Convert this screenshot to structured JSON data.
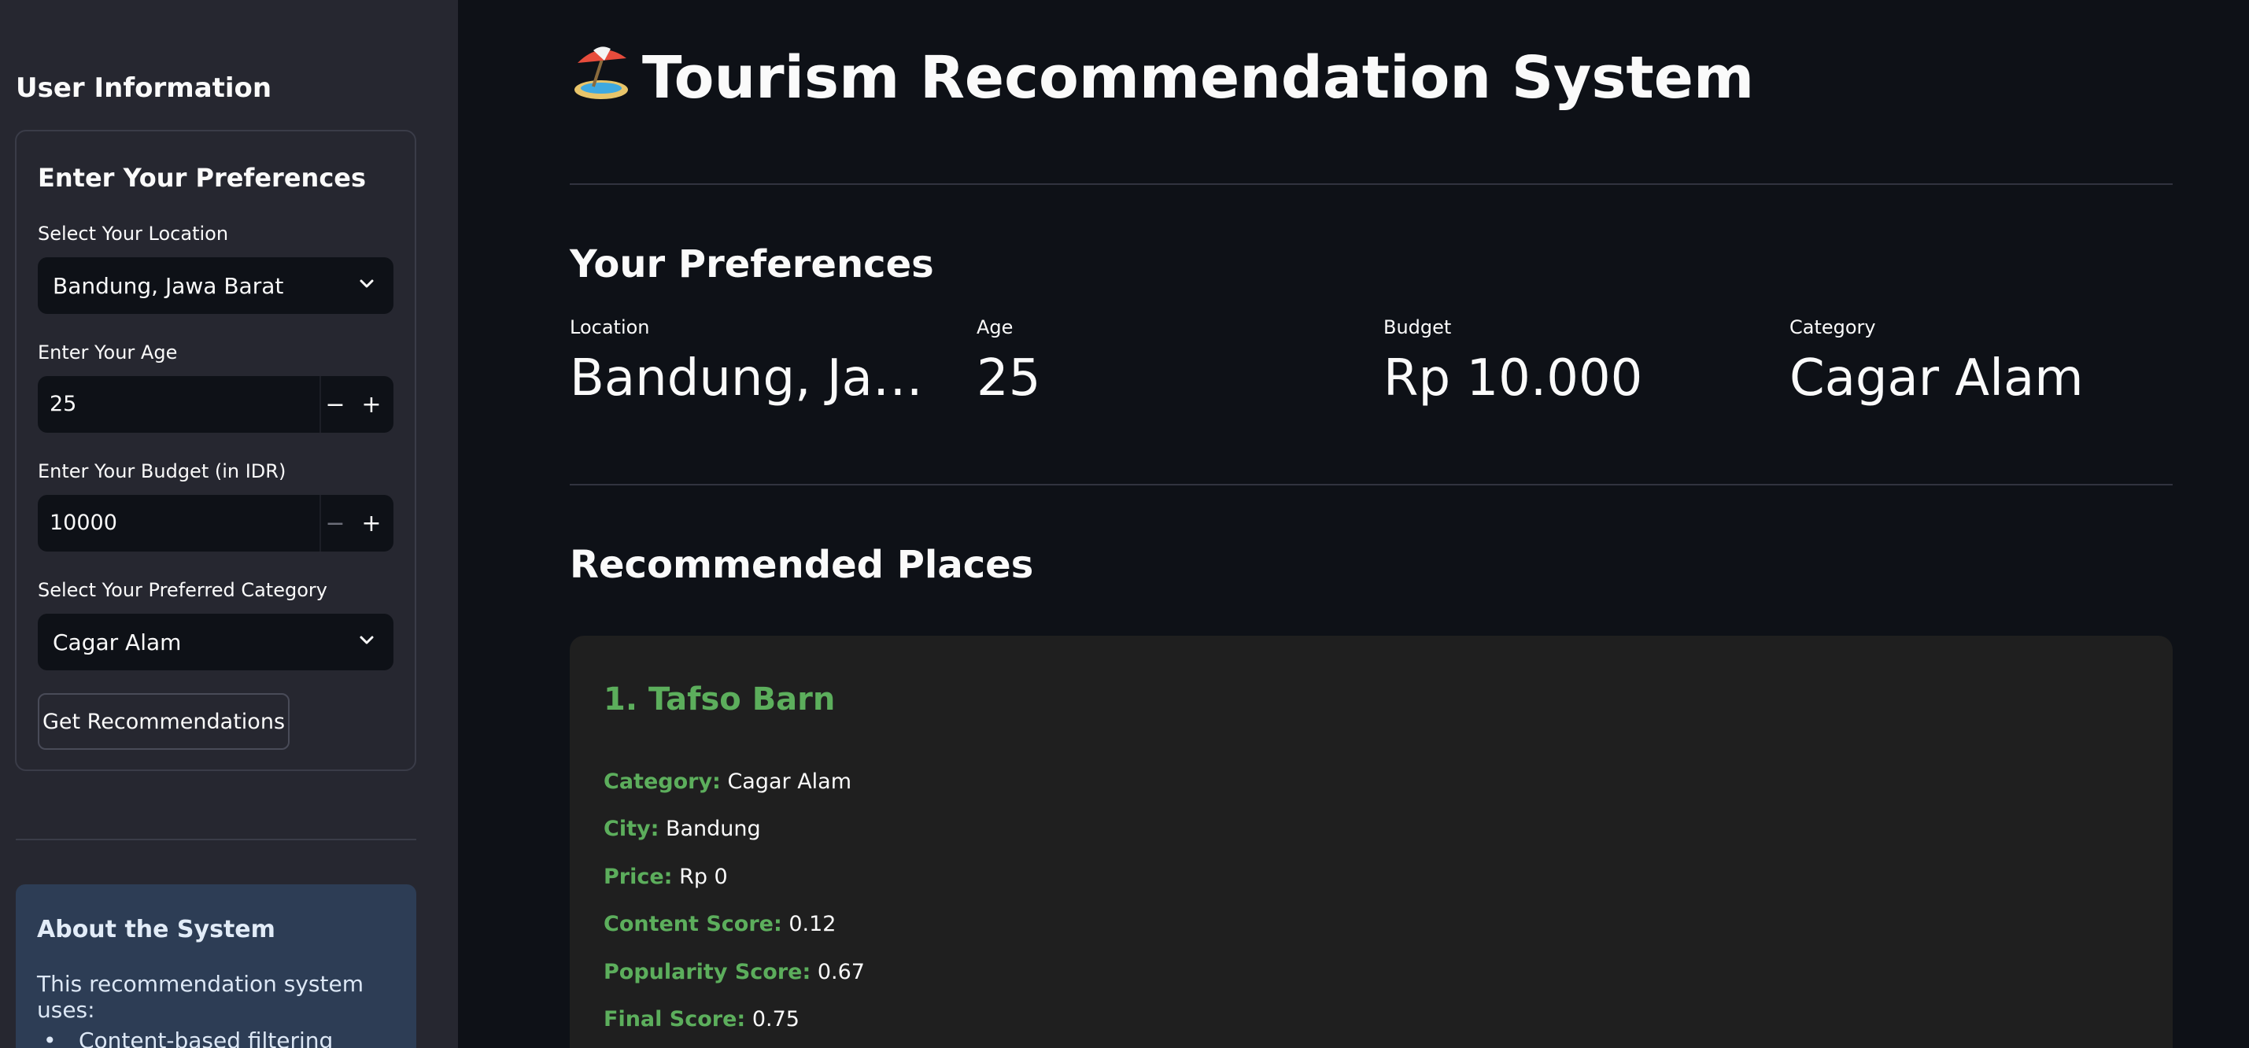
{
  "sidebar": {
    "title": "User Information",
    "form": {
      "title": "Enter Your Preferences",
      "location_label": "Select Your Location",
      "location_value": "Bandung, Jawa Barat",
      "age_label": "Enter Your Age",
      "age_value": "25",
      "budget_label": "Enter Your Budget (in IDR)",
      "budget_value": "10000",
      "category_label": "Select Your Preferred Category",
      "category_value": "Cagar Alam",
      "minus_label": "−",
      "plus_label": "+",
      "submit_label": "Get Recommendations"
    },
    "about": {
      "title": "About the System",
      "text": "This recommendation system uses:",
      "bullet": "•",
      "items": [
        "Content-based filtering"
      ]
    }
  },
  "main": {
    "title": "Tourism Recommendation System",
    "preferences": {
      "heading": "Your Preferences",
      "metrics": [
        {
          "label": "Location",
          "value": "Bandung, Jawa Barat"
        },
        {
          "label": "Age",
          "value": "25"
        },
        {
          "label": "Budget",
          "value": "Rp 10.000"
        },
        {
          "label": "Category",
          "value": "Cagar Alam"
        }
      ]
    },
    "recommended": {
      "heading": "Recommended Places",
      "items": [
        {
          "title": "1. Tafso Barn",
          "fields": [
            {
              "key": "Category:",
              "value": "Cagar Alam"
            },
            {
              "key": "City:",
              "value": "Bandung"
            },
            {
              "key": "Price:",
              "value": "Rp 0"
            },
            {
              "key": "Content Score:",
              "value": "0.12"
            },
            {
              "key": "Popularity Score:",
              "value": "0.67"
            },
            {
              "key": "Final Score:",
              "value": "0.75"
            }
          ]
        }
      ]
    }
  },
  "colors": {
    "background": "#0e1117",
    "sidebar": "#262730",
    "accent_green": "#5cae5c",
    "card": "#1f1f1f",
    "info_box": "#2d3d55"
  },
  "icons": {
    "title_icon": "beach-umbrella-icon",
    "select_icon": "chevron-down-icon"
  }
}
